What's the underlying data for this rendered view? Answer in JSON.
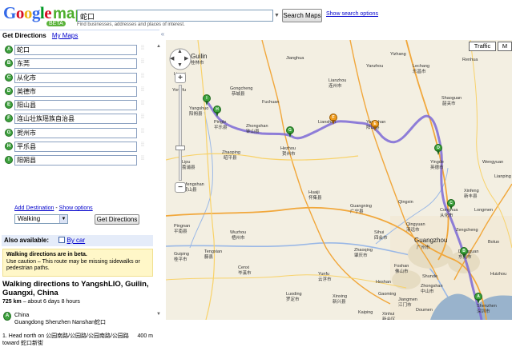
{
  "header": {
    "logo_text": "Google",
    "logo_maps": "maps",
    "logo_beta": "BETA",
    "search_value": "蛇口",
    "search_button": "Search Maps",
    "search_options": "Show search options",
    "search_hint": "Find businesses, addresses and places of interest."
  },
  "panel": {
    "tab_get_directions": "Get Directions",
    "tab_my_maps": "My Maps",
    "waypoints": [
      {
        "letter": "A",
        "value": "蛇口"
      },
      {
        "letter": "B",
        "value": "东莞"
      },
      {
        "letter": "C",
        "value": "从化市"
      },
      {
        "letter": "D",
        "value": "英德市"
      },
      {
        "letter": "E",
        "value": "阳山县"
      },
      {
        "letter": "F",
        "value": "连山壮族瑶族自治县"
      },
      {
        "letter": "G",
        "value": "贺州市"
      },
      {
        "letter": "H",
        "value": "平乐县"
      },
      {
        "letter": "I",
        "value": "阳朔县"
      }
    ],
    "add_destination": "Add Destination",
    "show_options": "Show options",
    "mode": "Walking",
    "get_directions_button": "Get Directions",
    "also_available": "Also available:",
    "by_car": "By car",
    "warning_title": "Walking directions are in beta.",
    "warning_text": "Use caution – This route may be missing sidewalks or pedestrian paths.",
    "route_title": "Walking directions to YangshLIO, Guilin, Guangxi, China",
    "route_distance": "725 km",
    "route_time": " – about 6 days 8 hours",
    "start_letter": "A",
    "start_country": "China",
    "start_address": "Guangdong Shenzhen Nanshan蛇口",
    "step1_text": "1. Head north on 公园南路/公园路/公园南路/公园路 toward 蛇口新街",
    "step1_dist": "400 m",
    "collapse": "«",
    "scroll_up": "▲",
    "scroll_down": "▼"
  },
  "map": {
    "traffic_button": "Traffic",
    "more_button": "M",
    "pan_up": "▲",
    "pan_left": "◀",
    "pan_right": "▶",
    "pan_down": "▼",
    "zoom_in": "+",
    "zoom_out": "−",
    "route_color": "#7b68d6",
    "pins": [
      {
        "letter": "I",
        "color": "green"
      },
      {
        "letter": "H",
        "color": "green"
      },
      {
        "letter": "G",
        "color": "green"
      },
      {
        "letter": "F",
        "color": "orange"
      },
      {
        "letter": "E",
        "color": "orange"
      },
      {
        "letter": "D",
        "color": "green"
      },
      {
        "letter": "C",
        "color": "green"
      },
      {
        "letter": "B",
        "color": "green"
      },
      {
        "letter": "A",
        "color": "green"
      }
    ],
    "labels": {
      "guilin": "Guilin",
      "guilin_cn": "桂林市",
      "yangshuo": "Yangshuo",
      "yangshuo_cn": "阳朔县",
      "gongcheng": "Gongcheng",
      "gongcheng_cn": "恭城县",
      "pingle": "Pingle",
      "pingle_cn": "平乐县",
      "zhongshan": "Zhongshan",
      "zhongshan_cn": "钟山县",
      "hezhou": "Hezhou",
      "hezhou_cn": "贺州市",
      "zhaoping": "Zhaoping",
      "zhaoping_cn": "昭平县",
      "lianzhou": "Lianzhou",
      "lianzhou_cn": "连州市",
      "lianshan": "Lianshan",
      "yangshan": "Yangshan",
      "yangshan_cn": "阳山县",
      "lechang": "Lechang",
      "lechang_cn": "乐昌市",
      "shaoguan": "Shaoguan",
      "shaoguan_cn": "韶关市",
      "renhua": "Renhua",
      "yingde": "Yingde",
      "yingde_cn": "英德市",
      "wengyuan": "Wengyuan",
      "conghua": "Conghua",
      "conghua_cn": "从化市",
      "guangzhou": "Guangzhou",
      "guangzhou_cn": "广州市",
      "dongguan": "Dongguan",
      "dongguan_cn": "东莞市",
      "shenzhen": "Shenzhen",
      "shenzhen_cn": "深圳市",
      "wuzhou": "Wuzhou",
      "wuzhou_cn": "梧州市",
      "zhaoqing": "Zhaoqing",
      "zhaoqing_cn": "肇庆市",
      "foshan": "Foshan",
      "foshan_cn": "佛山市",
      "jiangmen": "Jiangmen",
      "jiangmen_cn": "江门市",
      "zhongshan2": "Zhongshan",
      "zhongshan2_cn": "中山市",
      "yunfu": "Yunfu",
      "yunfu_cn": "云浮市",
      "xinxing": "Xinxing",
      "xinxing_cn": "新兴县",
      "luoding": "Luoding",
      "luoding_cn": "罗定市",
      "cenxi": "Cenxi",
      "cenxi_cn": "岑溪市",
      "pingnan": "Pingnan",
      "pingnan_cn": "平南县",
      "guiping": "Guiping",
      "guiping_cn": "桂平市",
      "lipu": "Lipu",
      "lipu_cn": "荔浦县",
      "mengshan": "Mengshan",
      "mengshan_cn": "蒙山县",
      "tengxian": "Tengxian",
      "tengxian_cn": "藤县",
      "huaiji": "Huaiji",
      "huaiji_cn": "怀集县",
      "guangning": "Guangning",
      "guangning_cn": "广宁县",
      "sihui": "Sihui",
      "sihui_cn": "四会市",
      "qingxin": "Qingxin",
      "qingyuan": "Qingyuan",
      "qingyuan_cn": "清远市",
      "huizhou": "Huizhou",
      "xinhui": "Xinhui",
      "xinhui_cn": "新会区",
      "kaiping": "Kaiping",
      "heshan": "Heshan",
      "zengcheng": "Zengcheng",
      "boluo": "Boluo",
      "longmen": "Longmen",
      "lianping": "Lianping",
      "xinfeng": "Xinfeng",
      "xinfeng_cn": "新丰县",
      "yanzhou": "Yanzhou",
      "yizhang": "Yizhang",
      "jianghua": "Jianghua",
      "fuchuan": "Fuchuan",
      "lingui": "Lingui",
      "yongfu": "Yongfu",
      "gaoming": "Gaoming",
      "doumen": "Doumen",
      "shunde": "Shunde"
    }
  }
}
